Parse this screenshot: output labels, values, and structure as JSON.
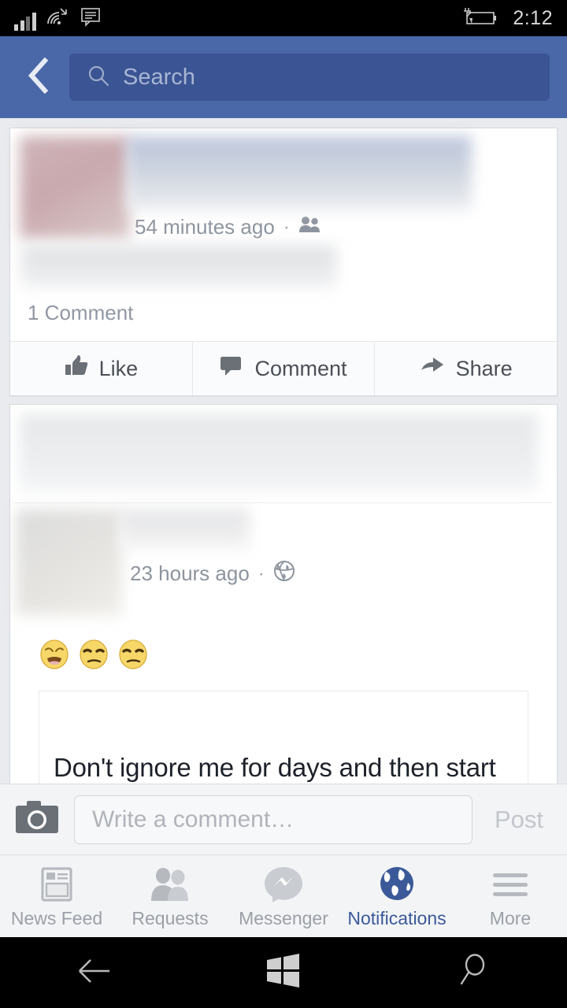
{
  "status_bar": {
    "signal_icon": "signal-bars-icon",
    "wifi_icon": "wifi-icon",
    "sms_icon": "sms-message-icon",
    "battery_icon": "battery-charging-icon",
    "time": "2:12"
  },
  "header": {
    "back_icon": "back-chevron-icon",
    "search_icon": "search-icon",
    "search_placeholder": "Search",
    "bg_color": "#4a68a7",
    "search_bg_color": "#3b5493"
  },
  "feed": {
    "posts": [
      {
        "id": "post-1",
        "author_redacted": true,
        "timestamp": "54 minutes ago",
        "privacy_icon": "friends-icon",
        "separator": "·",
        "comment_count": "1 Comment",
        "actions": [
          {
            "label": "Like",
            "icon": "thumbs-up-icon"
          },
          {
            "label": "Comment",
            "icon": "comment-bubble-icon"
          },
          {
            "label": "Share",
            "icon": "share-arrow-icon"
          }
        ]
      },
      {
        "id": "post-2",
        "author_redacted": true,
        "timestamp": "23 hours ago",
        "privacy_icon": "globe-public-icon",
        "separator": "·",
        "reactions": [
          "weary-face-emoji",
          "unamused-face-emoji",
          "unamused-face-emoji"
        ],
        "quote_text": "Don't ignore me for days and then start talking to me again like nothing"
      }
    ]
  },
  "composer": {
    "camera_icon": "camera-icon",
    "placeholder": "Write a comment…",
    "post_label": "Post"
  },
  "tabbar": {
    "tabs": [
      {
        "label": "News Feed",
        "icon": "news-feed-icon",
        "active": false
      },
      {
        "label": "Requests",
        "icon": "friend-requests-icon",
        "active": false
      },
      {
        "label": "Messenger",
        "icon": "messenger-icon",
        "active": false
      },
      {
        "label": "Notifications",
        "icon": "globe-notifications-icon",
        "active": true
      },
      {
        "label": "More",
        "icon": "hamburger-more-icon",
        "active": false
      }
    ],
    "active_color": "#3b5998",
    "inactive_color": "#9ba0a6"
  },
  "system_nav": {
    "back_icon": "system-back-arrow-icon",
    "start_icon": "windows-start-icon",
    "search_icon": "system-search-icon"
  }
}
